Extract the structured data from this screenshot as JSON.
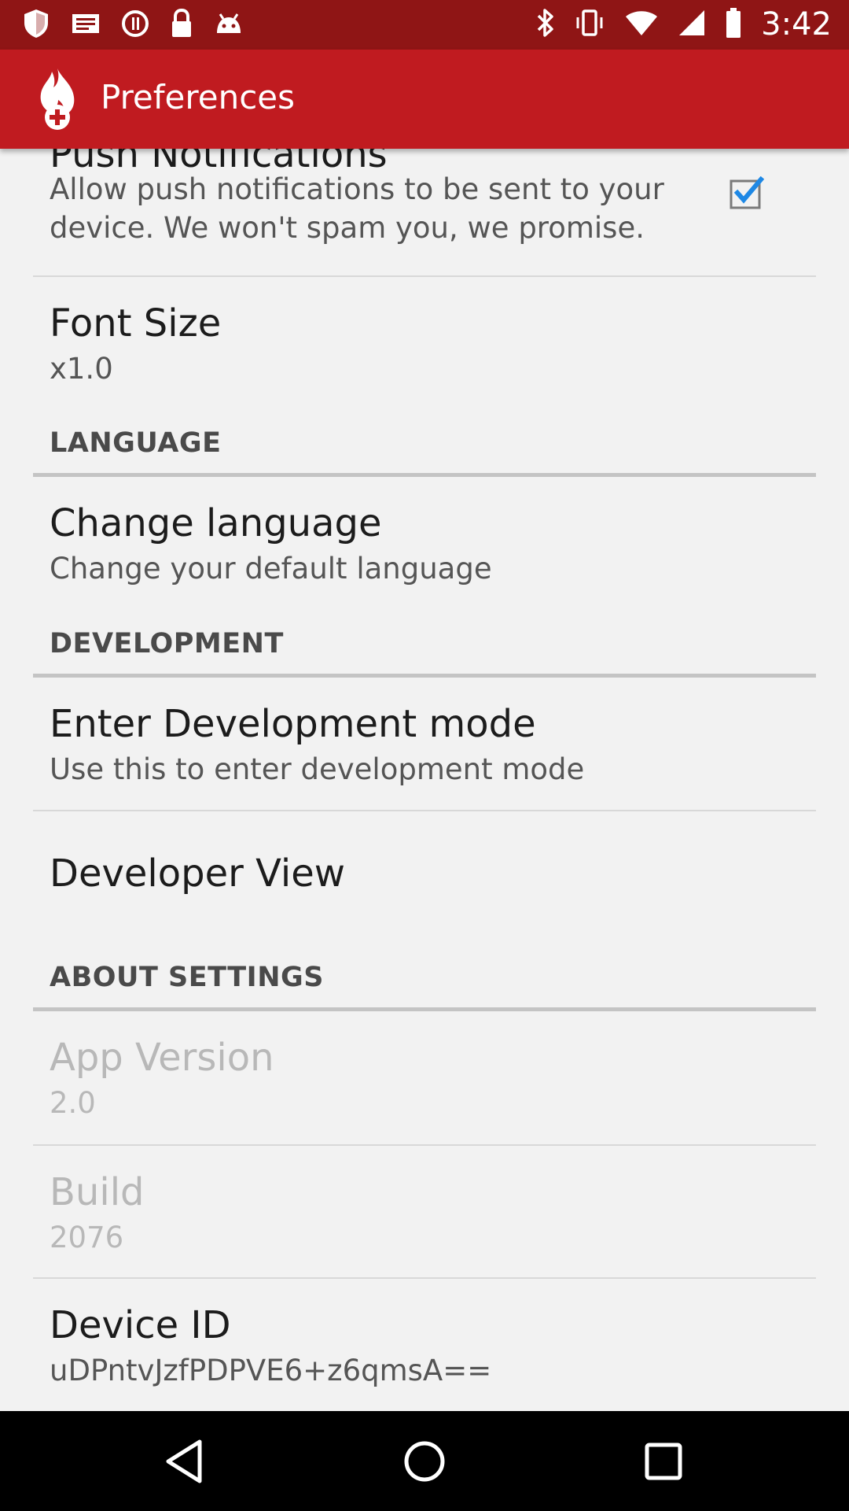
{
  "status_bar": {
    "time": "3:42"
  },
  "app_bar": {
    "title": "Preferences"
  },
  "preferences": {
    "push_notifications": {
      "title": "Push Notifications",
      "summary": "Allow push notifications to be sent to your device. We won't spam you, we promise.",
      "checked": true
    },
    "font_size": {
      "title": "Font Size",
      "summary": "x1.0"
    },
    "language_category": "LANGUAGE",
    "change_language": {
      "title": "Change language",
      "summary": "Change your default language"
    },
    "development_category": "DEVELOPMENT",
    "development_mode": {
      "title": "Enter Development mode",
      "summary": "Use this to enter development mode"
    },
    "developer_view": {
      "title": "Developer View"
    },
    "about_category": "ABOUT SETTINGS",
    "app_version": {
      "title": "App Version",
      "summary": "2.0"
    },
    "build": {
      "title": "Build",
      "summary": "2076"
    },
    "device_id": {
      "title": "Device ID",
      "summary": "uDPntvJzfPDPVE6+z6qmsA=="
    }
  },
  "colors": {
    "app_bar": "#c01b20",
    "status_bar": "#8f1515",
    "checkbox_tick": "#1e88e5",
    "background": "#f2f2f2"
  },
  "icons": {
    "status_left": [
      "shield-icon",
      "mail-icon",
      "sync-icon",
      "lock-icon",
      "android-icon"
    ],
    "status_right": [
      "bluetooth-icon",
      "vibrate-icon",
      "wifi-icon",
      "signal-icon",
      "battery-icon"
    ],
    "app": "flame-cross-logo-icon",
    "nav": [
      "back-icon",
      "home-icon",
      "recents-icon"
    ]
  }
}
